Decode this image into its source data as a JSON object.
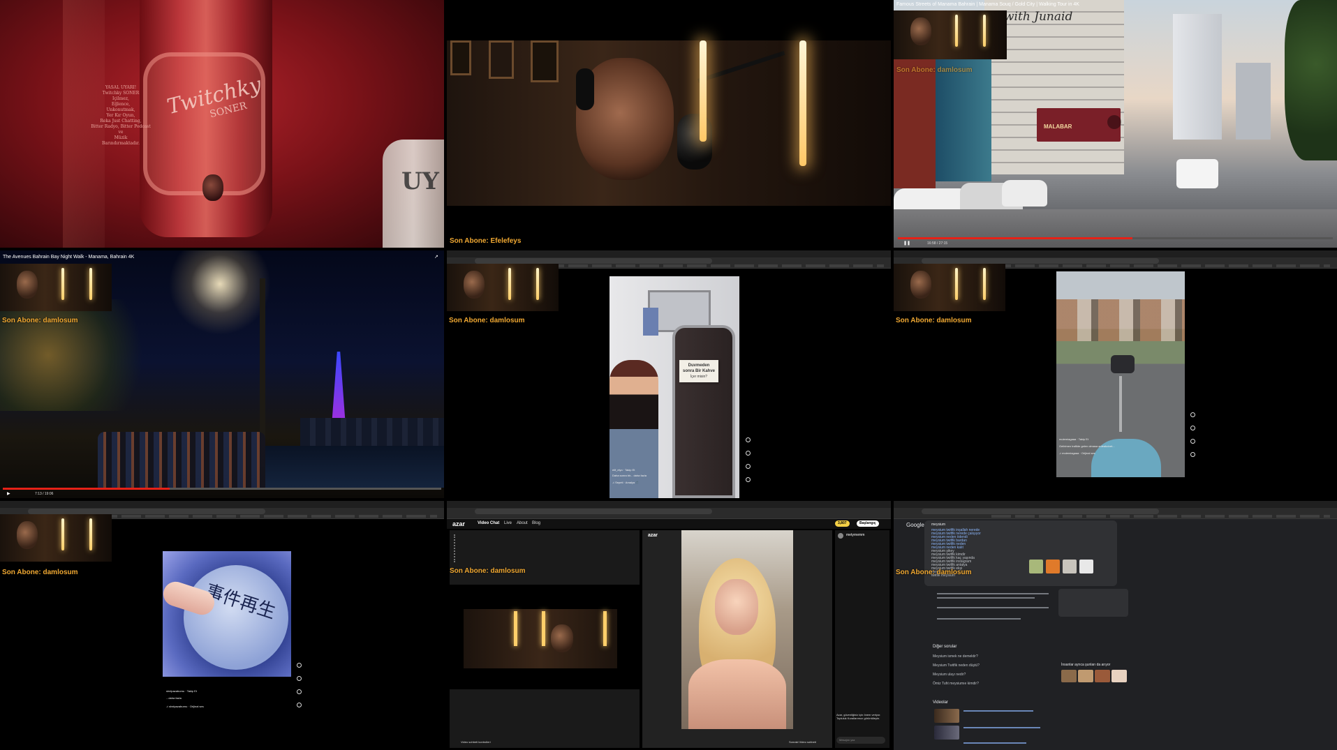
{
  "subscriber_prefix": "Son Abone:",
  "cells": {
    "c1": {
      "bottle_brand": "Twitchky",
      "bottle_sub": "SONER",
      "warning_lines": [
        "YASAL UYARI!",
        "Twitchky SONER",
        "Içilmez,",
        "Eğlence,",
        "Unkonutmak,",
        "Yer Kır Oyun,",
        "Reka Just Chatting,",
        "Bitter Radyo, Bitter Podcast",
        "ve",
        "Müzik",
        "Barındırmaktadır."
      ],
      "label_partial": "UY"
    },
    "c2": {
      "subscriber": "Efelefeys"
    },
    "c3": {
      "video_title": "Famous Streets of Manama Bahrain | Manama Souq / Gold City | Walking Tour in 4K",
      "overlay_text": "with Junaid",
      "sign_text": "MALABAR",
      "time": "16:58 / 27:15",
      "progress": 0.54
    },
    "c4": {
      "video_title": "The Avenues Bahrain Bay Night Walk - Manama, Bahrain 4K",
      "subscriber": "damlosum",
      "time": "7:13 / 19:06",
      "progress": 0.38
    },
    "c5": {
      "subscriber": "damlosum",
      "note_text": [
        "Duvmeden",
        "sonra Bir Kahve",
        "İçer misin?"
      ],
      "ig_user": "elif_elyo · Takip Et",
      "ig_caption": "Daha sonra bir... daha fazla",
      "ig_audio": "♫ Sepeti · Amalya 🎵"
    },
    "c6": {
      "subscriber": "damlosum",
      "ig_user": "mutemiagaaa · Takip Et",
      "ig_caption": "Gelirimen trafikte gelen olmasa anleakcivet...",
      "ig_audio": "♫ mutemiagaaa · Orijinal ses"
    },
    "c7": {
      "subscriber": "damlosum",
      "button_text": "事件再生",
      "ig_user": "shelpazaburnu · Takip Et",
      "ig_caption": "...daha fazla",
      "ig_audio": "♫ shelpazaburnu · Orijinal ses"
    },
    "c8": {
      "subscriber": "damlosum",
      "logo": "azar",
      "nav": [
        "Video Chat",
        "Live",
        "About",
        "Blog"
      ],
      "gems": "3,807",
      "login": "Başlangıç",
      "user": "metyrnemm",
      "bottom_left": "Video sohbeti kontrolleri",
      "bottom_right": "Sonraki Video sohbeti",
      "chat_placeholder": "Mesajını yaz",
      "notice": "Azar, güvenliğiniz için önem veriyor. Topluluk Kurallarımızı görüntüleyin."
    },
    "c9": {
      "subscriber": "damlosum",
      "google": "Google",
      "query": "meysium",
      "suggestions": [
        "meysium twitfik inşallah nerede",
        "meysium twitfik nerede çalışıyor",
        "meysium neden ödendi",
        "meysium twitfik bardan",
        "meysium twitfik neden",
        "meysium neden kalıt",
        "meysium şikey",
        "meysium twitfik kimdir",
        "meysium twitfik kaç yaşında",
        "meysium twitfik instagram",
        "meysium twitfik antalya",
        "meysium twitfik ekşi",
        "meyci",
        "twitfik meysium"
      ],
      "other_results": "Diğer sorular",
      "questions": [
        "Meysium ismek ne demektir?",
        "Meysium Twitfik neden düştü?",
        "Meysium ulayı nedir?",
        "Ömiz Tufıt meysiumıe kimdir?"
      ],
      "videos_head": "Videolar",
      "people_head": "İnsanlar ayrıca şunları da arıyor"
    }
  }
}
